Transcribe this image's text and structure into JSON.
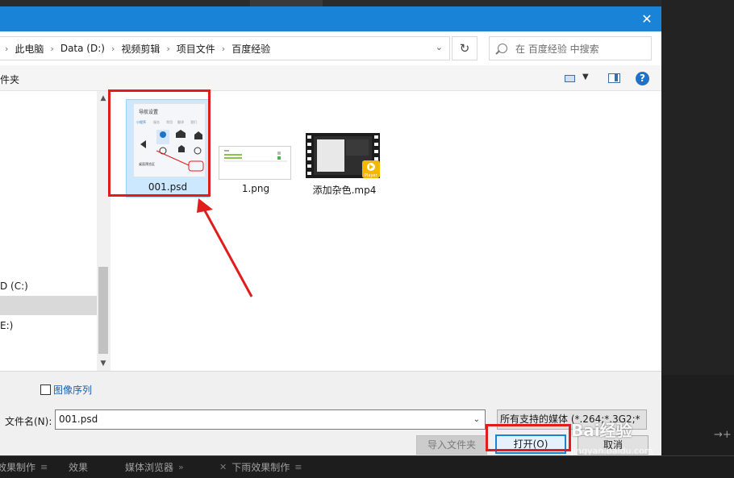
{
  "background": {
    "bottom_tabs": [
      "效果制作",
      "效果",
      "媒体浏览器",
      "下雨效果制作"
    ],
    "right_controls": "→+"
  },
  "dialog": {
    "close_glyph": "✕",
    "breadcrumbs": [
      "此电脑",
      "Data (D:)",
      "视频剪辑",
      "项目文件",
      "百度经验"
    ],
    "search_placeholder": "在 百度经验 中搜索",
    "toolbar_new_folder": "件夹",
    "help_glyph": "?",
    "nav_items": [
      "D (C:)",
      "E:)"
    ],
    "files": [
      {
        "name": "001.psd",
        "selected": true
      },
      {
        "name": "1.png",
        "selected": false
      },
      {
        "name": "添加杂色.mp4",
        "selected": false
      }
    ],
    "image_sequence_label": "图像序列",
    "filename_label": "文件名(N):",
    "filename_value": "001.psd",
    "file_type_filter": "所有支持的媒体 (*.264;*.3G2;*",
    "buttons": {
      "import_folder": "导入文件夹",
      "open": "打开(O)",
      "cancel": "取消"
    }
  },
  "thumbnail_text": {
    "psd_title": "导航设置",
    "psd_tabs": [
      "小程序",
      "服务",
      "常用",
      "翻译",
      "我们"
    ],
    "psd_icons": [
      "收藏",
      "通知管理",
      "平安",
      "平安关注",
      "我的",
      "设置"
    ],
    "psd_footer": "桌面预览区",
    "mp4_badge": "Player"
  },
  "watermark": {
    "text": "Bai经验",
    "sub": "jingyan.baidu.com"
  },
  "colors": {
    "titlebar": "#1883d7",
    "selection": "#cce8ff",
    "annotation": "#e21b1b"
  }
}
